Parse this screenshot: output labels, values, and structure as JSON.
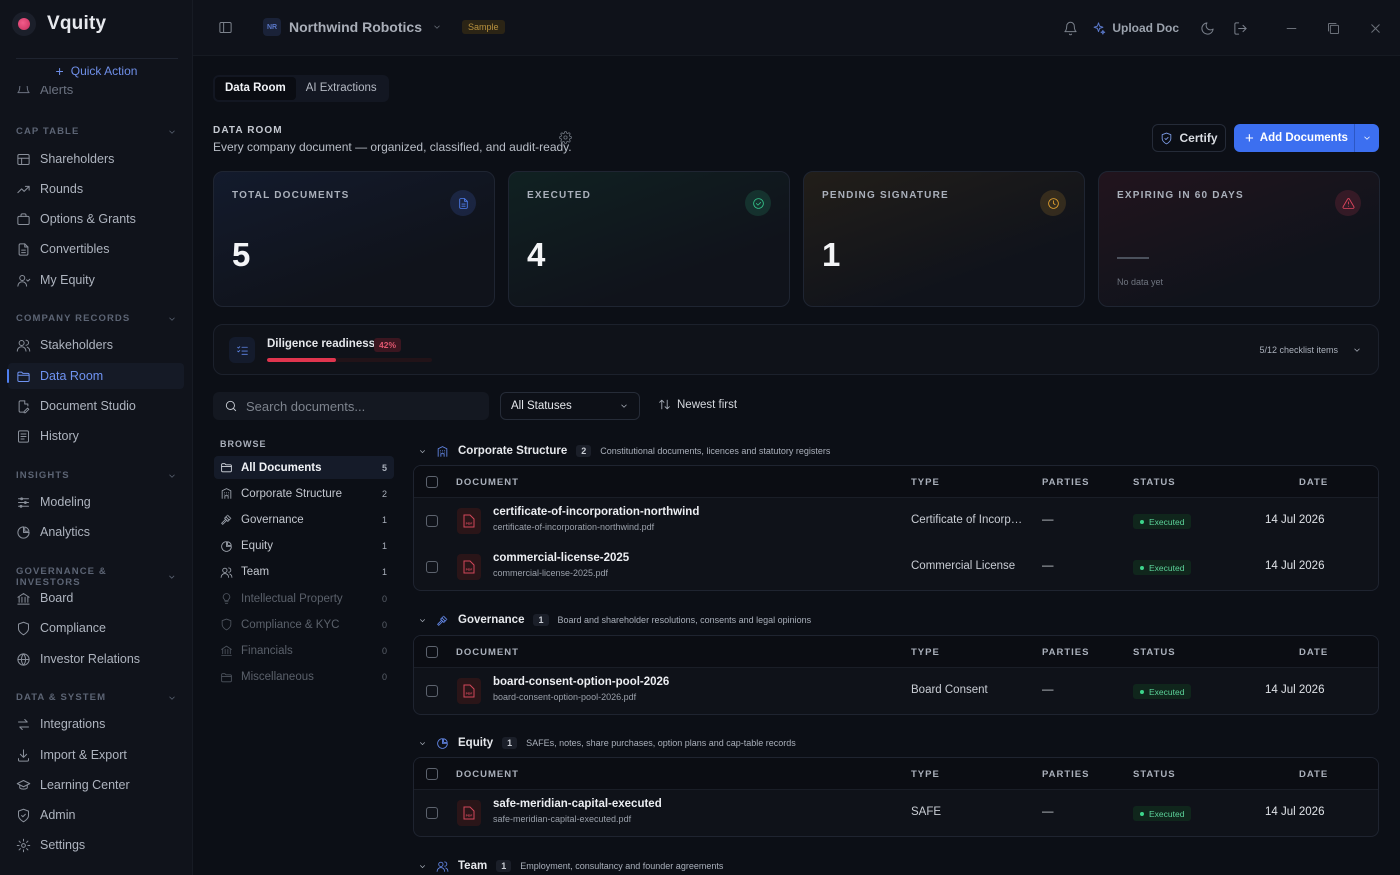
{
  "brand": {
    "name": "Vquity"
  },
  "quick_action": "Quick Action",
  "sidebar": {
    "alerts_label": "Alerts",
    "sections": [
      {
        "label": "CAP TABLE",
        "items": [
          {
            "label": "Shareholders",
            "icon": "table-icon"
          },
          {
            "label": "Rounds",
            "icon": "trend-icon"
          },
          {
            "label": "Options & Grants",
            "icon": "briefcase-icon"
          },
          {
            "label": "Convertibles",
            "icon": "file-icon"
          },
          {
            "label": "My Equity",
            "icon": "user-icon"
          }
        ]
      },
      {
        "label": "COMPANY RECORDS",
        "items": [
          {
            "label": "Stakeholders",
            "icon": "users-icon"
          },
          {
            "label": "Data Room",
            "icon": "folder-icon",
            "active": true
          },
          {
            "label": "Document Studio",
            "icon": "file-edit-icon"
          },
          {
            "label": "History",
            "icon": "history-icon"
          }
        ]
      },
      {
        "label": "INSIGHTS",
        "items": [
          {
            "label": "Modeling",
            "icon": "sliders-icon"
          },
          {
            "label": "Analytics",
            "icon": "pie-icon"
          }
        ]
      },
      {
        "label": "GOVERNANCE & INVESTORS",
        "items": [
          {
            "label": "Board",
            "icon": "bank-icon"
          },
          {
            "label": "Compliance",
            "icon": "shield-icon"
          },
          {
            "label": "Investor Relations",
            "icon": "globe-icon"
          }
        ]
      },
      {
        "label": "DATA & SYSTEM",
        "items": [
          {
            "label": "Integrations",
            "icon": "swap-icon"
          },
          {
            "label": "Import & Export",
            "icon": "download-icon"
          },
          {
            "label": "Learning Center",
            "icon": "cap-icon"
          },
          {
            "label": "Admin",
            "icon": "shield-check-icon"
          },
          {
            "label": "Settings",
            "icon": "gear-icon"
          }
        ]
      }
    ]
  },
  "topbar": {
    "org_initials": "NR",
    "org_name": "Northwind Robotics",
    "sample_badge": "Sample",
    "upload_label": "Upload Doc"
  },
  "tabs": [
    "Data Room",
    "AI Extractions"
  ],
  "header": {
    "title": "DATA ROOM",
    "subtitle": "Every company document — organized, classified, and audit-ready.",
    "certify_label": "Certify",
    "add_label": "Add Documents"
  },
  "stats": [
    {
      "label": "TOTAL DOCUMENTS",
      "value": "5",
      "icon": "file-icon",
      "color": "#4f7ff0"
    },
    {
      "label": "EXECUTED",
      "value": "4",
      "icon": "check-circle-icon",
      "color": "#34c088"
    },
    {
      "label": "PENDING SIGNATURE",
      "value": "1",
      "icon": "clock-icon",
      "color": "#e0a030"
    },
    {
      "label": "EXPIRING IN 60 DAYS",
      "value": "",
      "icon": "alert-icon",
      "color": "#e0455e",
      "empty_text": "No data yet"
    }
  ],
  "diligence": {
    "title": "Diligence readiness",
    "percent": "42%",
    "progress": 0.42,
    "checklist": "5/12 checklist items"
  },
  "filters": {
    "search_placeholder": "Search documents...",
    "status": "All Statuses",
    "sort": "Newest first"
  },
  "browse": {
    "label": "BROWSE",
    "items": [
      {
        "label": "All Documents",
        "count": "5",
        "icon": "folder-icon",
        "active": true
      },
      {
        "label": "Corporate Structure",
        "count": "2",
        "icon": "building-icon"
      },
      {
        "label": "Governance",
        "count": "1",
        "icon": "gavel-icon"
      },
      {
        "label": "Equity",
        "count": "1",
        "icon": "pie-icon"
      },
      {
        "label": "Team",
        "count": "1",
        "icon": "users-icon"
      },
      {
        "label": "Intellectual Property",
        "count": "0",
        "icon": "bulb-icon",
        "dim": true
      },
      {
        "label": "Compliance & KYC",
        "count": "0",
        "icon": "shield-icon",
        "dim": true
      },
      {
        "label": "Financials",
        "count": "0",
        "icon": "bank-icon",
        "dim": true
      },
      {
        "label": "Miscellaneous",
        "count": "0",
        "icon": "folder-icon",
        "dim": true
      }
    ]
  },
  "table_headers": {
    "document": "DOCUMENT",
    "type": "TYPE",
    "parties": "PARTIES",
    "status": "STATUS",
    "date": "DATE"
  },
  "groups": [
    {
      "name": "Corporate Structure",
      "count": "2",
      "desc": "Constitutional documents, licences and statutory registers",
      "icon": "building-icon",
      "rows": [
        {
          "name": "certificate-of-incorporation-northwind",
          "file": "certificate-of-incorporation-northwind.pdf",
          "type": "Certificate of Incorporation",
          "parties": "—",
          "status": "Executed",
          "date": "14 Jul 2026"
        },
        {
          "name": "commercial-license-2025",
          "file": "commercial-license-2025.pdf",
          "type": "Commercial License",
          "parties": "—",
          "status": "Executed",
          "date": "14 Jul 2026"
        }
      ]
    },
    {
      "name": "Governance",
      "count": "1",
      "desc": "Board and shareholder resolutions, consents and legal opinions",
      "icon": "gavel-icon",
      "rows": [
        {
          "name": "board-consent-option-pool-2026",
          "file": "board-consent-option-pool-2026.pdf",
          "type": "Board Consent",
          "parties": "—",
          "status": "Executed",
          "date": "14 Jul 2026"
        }
      ]
    },
    {
      "name": "Equity",
      "count": "1",
      "desc": "SAFEs, notes, share purchases, option plans and cap-table records",
      "icon": "pie-icon",
      "rows": [
        {
          "name": "safe-meridian-capital-executed",
          "file": "safe-meridian-capital-executed.pdf",
          "type": "SAFE",
          "parties": "—",
          "status": "Executed",
          "date": "14 Jul 2026"
        }
      ]
    },
    {
      "name": "Team",
      "count": "1",
      "desc": "Employment, consultancy and founder agreements",
      "icon": "users-icon",
      "rows": []
    }
  ]
}
